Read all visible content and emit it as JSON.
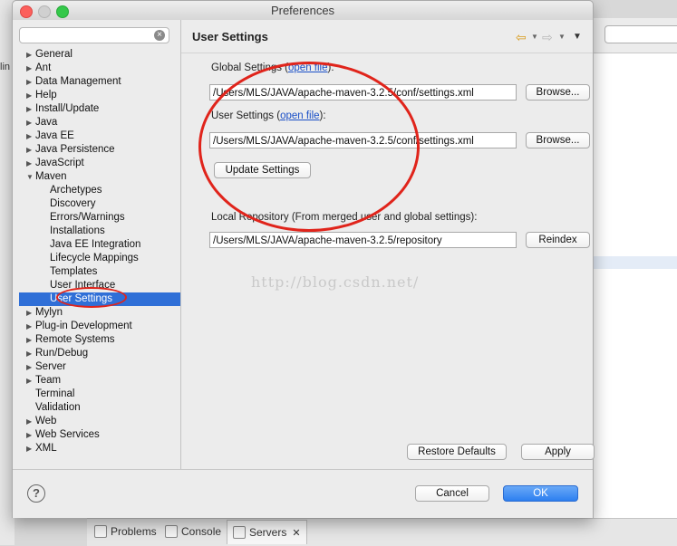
{
  "window": {
    "title": "Preferences"
  },
  "filter": {
    "placeholder": "",
    "clear_icon": "clear-icon"
  },
  "tree": {
    "items": [
      {
        "label": "General",
        "level": 0,
        "expandable": true
      },
      {
        "label": "Ant",
        "level": 0,
        "expandable": true
      },
      {
        "label": "Data Management",
        "level": 0,
        "expandable": true
      },
      {
        "label": "Help",
        "level": 0,
        "expandable": true
      },
      {
        "label": "Install/Update",
        "level": 0,
        "expandable": true
      },
      {
        "label": "Java",
        "level": 0,
        "expandable": true
      },
      {
        "label": "Java EE",
        "level": 0,
        "expandable": true
      },
      {
        "label": "Java Persistence",
        "level": 0,
        "expandable": true
      },
      {
        "label": "JavaScript",
        "level": 0,
        "expandable": true
      },
      {
        "label": "Maven",
        "level": 0,
        "expandable": true,
        "expanded": true
      },
      {
        "label": "Archetypes",
        "level": 1
      },
      {
        "label": "Discovery",
        "level": 1
      },
      {
        "label": "Errors/Warnings",
        "level": 1
      },
      {
        "label": "Installations",
        "level": 1
      },
      {
        "label": "Java EE Integration",
        "level": 1
      },
      {
        "label": "Lifecycle Mappings",
        "level": 1
      },
      {
        "label": "Templates",
        "level": 1
      },
      {
        "label": "User Interface",
        "level": 1
      },
      {
        "label": "User Settings",
        "level": 1,
        "selected": true
      },
      {
        "label": "Mylyn",
        "level": 0,
        "expandable": true
      },
      {
        "label": "Plug-in Development",
        "level": 0,
        "expandable": true
      },
      {
        "label": "Remote Systems",
        "level": 0,
        "expandable": true
      },
      {
        "label": "Run/Debug",
        "level": 0,
        "expandable": true
      },
      {
        "label": "Server",
        "level": 0,
        "expandable": true
      },
      {
        "label": "Team",
        "level": 0,
        "expandable": true
      },
      {
        "label": "Terminal",
        "level": 0
      },
      {
        "label": "Validation",
        "level": 0
      },
      {
        "label": "Web",
        "level": 0,
        "expandable": true
      },
      {
        "label": "Web Services",
        "level": 0,
        "expandable": true
      },
      {
        "label": "XML",
        "level": 0,
        "expandable": true
      }
    ]
  },
  "page": {
    "title": "User Settings",
    "global_label_pre": "Global Settings (",
    "global_link": "open file",
    "global_label_post": "):",
    "global_path": "/Users/MLS/JAVA/apache-maven-3.2.5/conf/settings.xml",
    "user_label_pre": "User Settings (",
    "user_link": "open file",
    "user_label_post": "):",
    "user_path": "/Users/MLS/JAVA/apache-maven-3.2.5/conf/settings.xml",
    "browse_label": "Browse...",
    "update_label": "Update Settings",
    "local_repo_label": "Local Repository (From merged user and global settings):",
    "local_repo_path": "/Users/MLS/JAVA/apache-maven-3.2.5/repository",
    "reindex_label": "Reindex",
    "restore_label": "Restore Defaults",
    "apply_label": "Apply"
  },
  "watermark": "http://blog.csdn.net/",
  "footer": {
    "cancel_label": "Cancel",
    "ok_label": "OK",
    "help_glyph": "?"
  },
  "background": {
    "tabs": [
      "Problems",
      "Console",
      "Servers"
    ],
    "left_text": "lin"
  },
  "annotation_color": "#e0241b",
  "selection_color": "#2f6fd7"
}
